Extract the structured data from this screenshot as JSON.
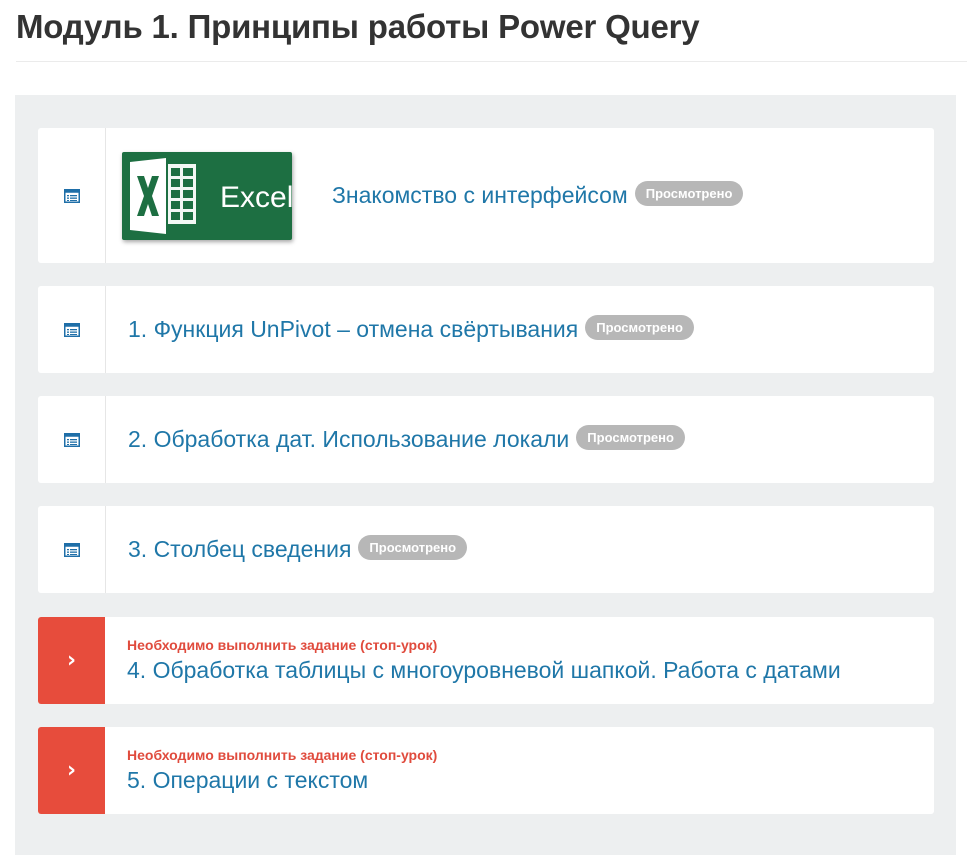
{
  "module": {
    "title": "Модуль 1. Принципы работы Power Query"
  },
  "colors": {
    "link": "#1f77a8",
    "badge": "#b7b7b7",
    "stop": "#e74c3c",
    "panel": "#edeff0",
    "excel_green": "#1d6f42"
  },
  "lessons": [
    {
      "title": "Знакомство с интерфейсом",
      "badge": "Просмотрено",
      "icon": "document-icon",
      "thumbnail": {
        "kind": "excel-logo",
        "text": "Excel"
      }
    },
    {
      "title": "1. Функция UnPivot – отмена свёртывания",
      "badge": "Просмотрено",
      "icon": "document-icon"
    },
    {
      "title": "2. Обработка дат. Использование локали",
      "badge": "Просмотрено",
      "icon": "document-icon"
    },
    {
      "title": "3. Столбец сведения",
      "badge": "Просмотрено",
      "icon": "document-icon"
    },
    {
      "title": "4. Обработка таблицы с многоуровневой шапкой. Работа с датами",
      "note": "Необходимо выполнить задание (стоп-урок)",
      "icon": "chevron-right-icon",
      "chevron": "›"
    },
    {
      "title": "5. Операции с текстом",
      "note": "Необходимо выполнить задание (стоп-урок)",
      "icon": "chevron-right-icon",
      "chevron": "›"
    }
  ]
}
